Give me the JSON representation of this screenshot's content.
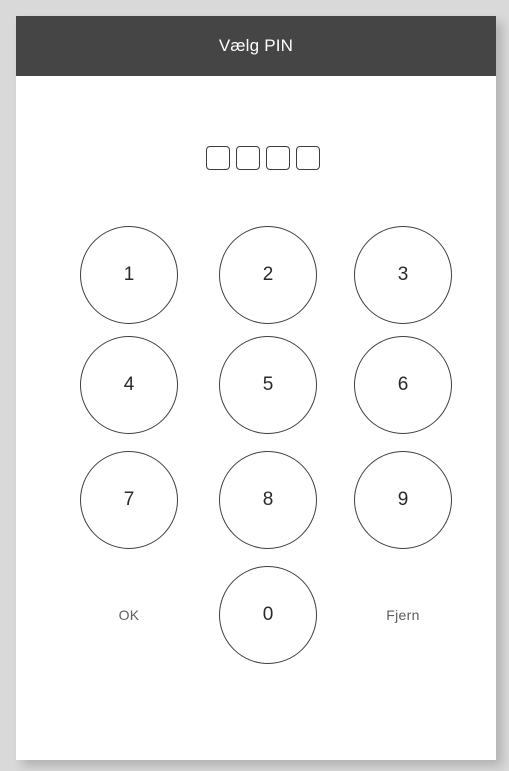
{
  "header": {
    "title": "Vælg PIN"
  },
  "pin": {
    "slots": 4,
    "filled": 0
  },
  "keypad": {
    "keys": [
      "1",
      "2",
      "3",
      "4",
      "5",
      "6",
      "7",
      "8",
      "9",
      "0"
    ],
    "ok_label": "OK",
    "delete_label": "Fjern"
  },
  "colors": {
    "header_bg": "#454545",
    "header_text": "#ffffff",
    "outline": "#3f3f3f",
    "secondary_text": "#5e5e5e",
    "frame_bg": "#d9d9d9",
    "device_bg": "#ffffff"
  }
}
